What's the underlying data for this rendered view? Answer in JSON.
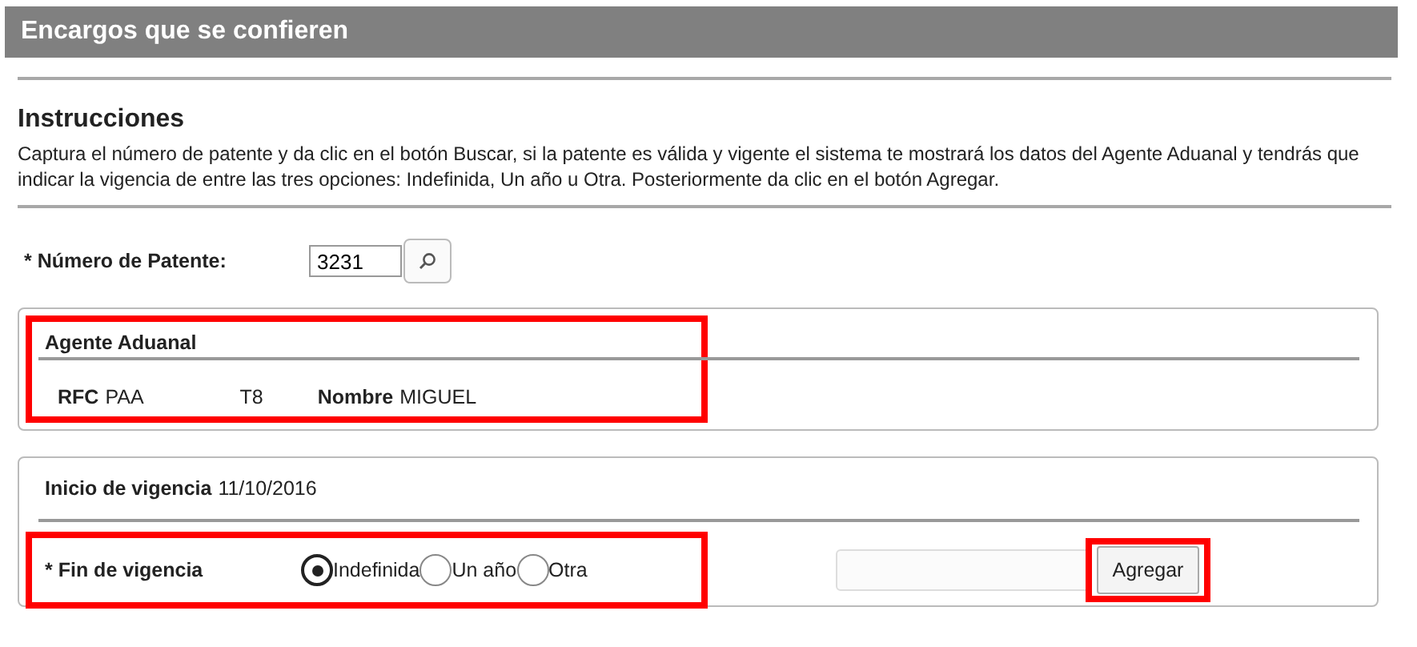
{
  "header": {
    "title": "Encargos que se confieren"
  },
  "instructions": {
    "heading": "Instrucciones",
    "text": "Captura el número de patente y da clic en el botón Buscar, si la patente es válida y vigente el sistema te mostrará los datos del Agente Aduanal y tendrás que indicar la vigencia de entre las tres opciones: Indefinida, Un año u Otra. Posteriormente da clic en el botón Agregar."
  },
  "patent": {
    "label": "* Número de Patente:",
    "value": "3231"
  },
  "agent": {
    "heading": "Agente Aduanal",
    "highlighted": true,
    "rfc_label": "RFC",
    "rfc_parts": [
      "PAA",
      "T8"
    ],
    "name_label": "Nombre",
    "name_value": "MIGUEL"
  },
  "validity": {
    "start_label": "Inicio de vigencia",
    "start_value": "11/10/2016",
    "end_label": "* Fin de vigencia",
    "end_highlighted": true,
    "options": [
      {
        "label": "Indefinida",
        "selected": true
      },
      {
        "label": "Un año",
        "selected": false
      },
      {
        "label": "Otra",
        "selected": false
      }
    ],
    "add_button": {
      "label": "Agregar",
      "highlighted": true
    }
  }
}
